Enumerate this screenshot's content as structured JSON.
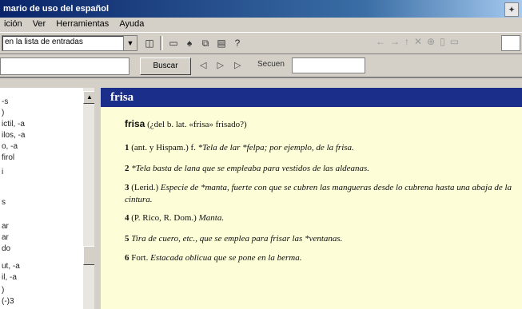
{
  "window": {
    "title": "mario de uso del español"
  },
  "menu": [
    "ición",
    "Ver",
    "Herramientas",
    "Ayuda"
  ],
  "toolbar": {
    "combo_value": "en la lista de entradas",
    "buscar_label": "Buscar",
    "nav_arrows": "◁ ▷ ▷",
    "sequence_label": "Secuen"
  },
  "left_list": [
    "-s",
    ")",
    "ictil, -a",
    "ilos, -a",
    "o, -a",
    "firol",
    "i",
    "s",
    "ar",
    "",
    "ar",
    "do",
    "",
    "",
    "",
    "ut, -a",
    "il, -a",
    "",
    ")",
    "(-)3"
  ],
  "content": {
    "header": "frisa",
    "headword": "frisa",
    "etym": "(¿del b. lat. «frisa» frisado?)",
    "senses": [
      {
        "n": "1",
        "pre": "(ant. y Hispam.) f. ",
        "def": "*Tela de lar *felpa; por ejemplo, de la frisa."
      },
      {
        "n": "2",
        "pre": "",
        "def": "*Tela basta de lana que se empleaba para vestidos de las aldeanas."
      },
      {
        "n": "3",
        "pre": "(Lerid.) ",
        "def": "Especie de *manta, fuerte con que se cubren las mangueras desde lo cubrena hasta una abaja de la cintura."
      },
      {
        "n": "4",
        "pre": "(P. Rico, R. Dom.) ",
        "def": "Manta."
      },
      {
        "n": "5",
        "pre": "",
        "def": "Tira de cuero, etc., que se emplea para frisar las *ventanas."
      },
      {
        "n": "6",
        "pre": "Fort. ",
        "def": "Estacada oblicua que se pone en la berma."
      }
    ]
  }
}
